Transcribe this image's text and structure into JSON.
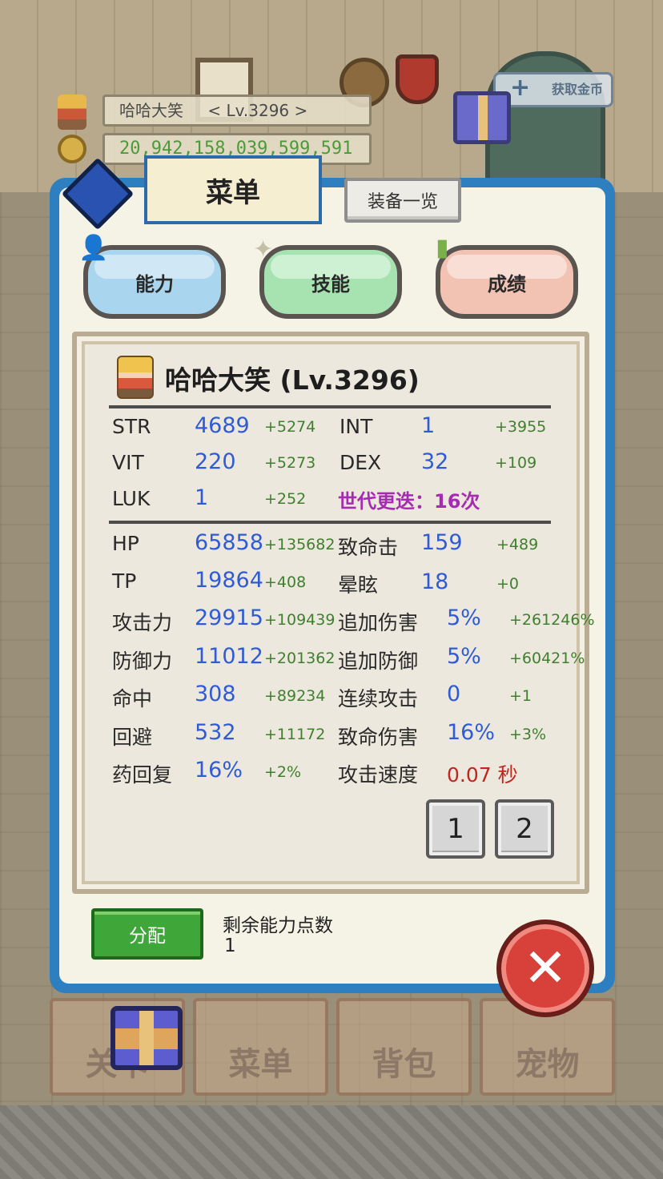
{
  "hud": {
    "player_name": "哈哈大笑",
    "player_level": "< Lv.3296 >",
    "gold": "20,942,158,039,599,591",
    "get_gold_label": "获取金币"
  },
  "menu": {
    "title": "菜单",
    "equipment_list_label": "装备一览",
    "tabs": [
      {
        "label": "能力"
      },
      {
        "label": "技能"
      },
      {
        "label": "成绩"
      }
    ]
  },
  "character": {
    "title": "哈哈大笑 (Lv.3296)",
    "generation_text": "世代更迭：16次"
  },
  "base_stats": [
    {
      "label": "STR",
      "value": "4689",
      "bonus": "+5274"
    },
    {
      "label": "VIT",
      "value": "220",
      "bonus": "+5273"
    },
    {
      "label": "LUK",
      "value": "1",
      "bonus": "+252"
    },
    {
      "label": "INT",
      "value": "1",
      "bonus": "+3955"
    },
    {
      "label": "DEX",
      "value": "32",
      "bonus": "+109"
    }
  ],
  "combat_stats_left": [
    {
      "label": "HP",
      "value": "65858",
      "bonus": "+135682"
    },
    {
      "label": "TP",
      "value": "19864",
      "bonus": "+408"
    },
    {
      "label": "攻击力",
      "value": "29915",
      "bonus": "+109439"
    },
    {
      "label": "防御力",
      "value": "11012",
      "bonus": "+201362"
    },
    {
      "label": "命中",
      "value": "308",
      "bonus": "+89234"
    },
    {
      "label": "回避",
      "value": "532",
      "bonus": "+11172"
    },
    {
      "label": "药回复",
      "value": "16%",
      "bonus": "+2%"
    }
  ],
  "combat_stats_right": [
    {
      "label": "致命击",
      "value": "159",
      "bonus": "+489"
    },
    {
      "label": "晕眩",
      "value": "18",
      "bonus": "+0"
    },
    {
      "label": "追加伤害",
      "value": "5%",
      "bonus": "+261246%"
    },
    {
      "label": "追加防御",
      "value": "5%",
      "bonus": "+60421%"
    },
    {
      "label": "连续攻击",
      "value": "0",
      "bonus": "+1"
    },
    {
      "label": "致命伤害",
      "value": "16%",
      "bonus": "+3%"
    },
    {
      "label": "攻击速度",
      "value": "0.07 秒",
      "bonus": ""
    }
  ],
  "pagination": [
    "1",
    "2"
  ],
  "allocation": {
    "button_label": "分配",
    "remaining_label": "剩余能力点数",
    "remaining_value": "1"
  },
  "bottom_nav": [
    {
      "label": "关卡"
    },
    {
      "label": "菜单"
    },
    {
      "label": "背包"
    },
    {
      "label": "宠物"
    }
  ],
  "colors": {
    "panel_blue": "#2e7fbf",
    "value_blue": "#2f5bd6",
    "bonus_green": "#3f7f2e",
    "generation_purple": "#a52cb2",
    "attack_speed_red": "#c0251e"
  }
}
